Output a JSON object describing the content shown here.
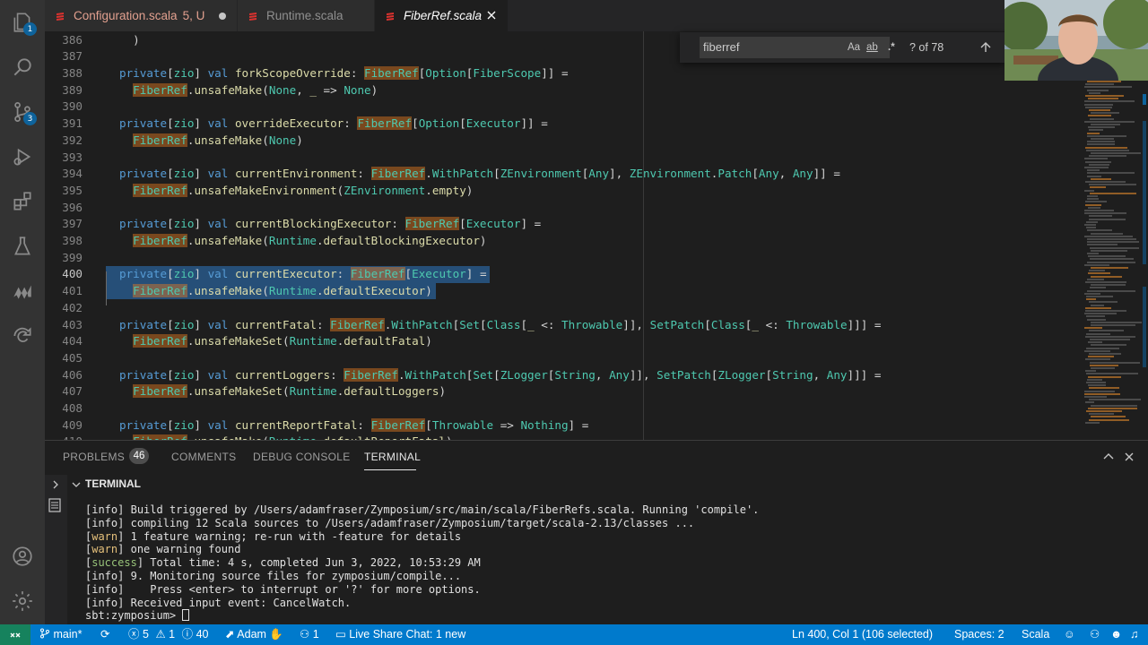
{
  "tabs": [
    {
      "label": "Configuration.scala",
      "status": "5, U"
    },
    {
      "label": "Runtime.scala"
    },
    {
      "label": "FiberRef.scala"
    }
  ],
  "activity_badges": {
    "explorer": "1",
    "source_control": "3"
  },
  "find": {
    "query": "fiberref",
    "opt_case": "Aa",
    "opt_word": "ab",
    "opt_regex": ".*",
    "count": "? of 78"
  },
  "editor_lines": [
    {
      "num": "386",
      "code": "  )"
    },
    {
      "num": "387",
      "code": ""
    },
    {
      "num": "388",
      "code": "private[zio] val forkScopeOverride: FiberRef[Option[FiberScope]] ="
    },
    {
      "num": "389",
      "code": "  FiberRef.unsafeMake(None, _ => None)"
    },
    {
      "num": "390",
      "code": ""
    },
    {
      "num": "391",
      "code": "private[zio] val overrideExecutor: FiberRef[Option[Executor]] ="
    },
    {
      "num": "392",
      "code": "  FiberRef.unsafeMake(None)"
    },
    {
      "num": "393",
      "code": ""
    },
    {
      "num": "394",
      "code": "private[zio] val currentEnvironment: FiberRef.WithPatch[ZEnvironment[Any], ZEnvironment.Patch[Any, Any]] ="
    },
    {
      "num": "395",
      "code": "  FiberRef.unsafeMakeEnvironment(ZEnvironment.empty)"
    },
    {
      "num": "396",
      "code": ""
    },
    {
      "num": "397",
      "code": "private[zio] val currentBlockingExecutor: FiberRef[Executor] ="
    },
    {
      "num": "398",
      "code": "  FiberRef.unsafeMake(Runtime.defaultBlockingExecutor)"
    },
    {
      "num": "399",
      "code": ""
    },
    {
      "num": "400",
      "code": "private[zio] val currentExecutor: FiberRef[Executor] ="
    },
    {
      "num": "401",
      "code": "  FiberRef.unsafeMake(Runtime.defaultExecutor)"
    },
    {
      "num": "402",
      "code": ""
    },
    {
      "num": "403",
      "code": "private[zio] val currentFatal: FiberRef.WithPatch[Set[Class[_ <: Throwable]], SetPatch[Class[_ <: Throwable]]] ="
    },
    {
      "num": "404",
      "code": "  FiberRef.unsafeMakeSet(Runtime.defaultFatal)"
    },
    {
      "num": "405",
      "code": ""
    },
    {
      "num": "406",
      "code": "private[zio] val currentLoggers: FiberRef.WithPatch[Set[ZLogger[String, Any]], SetPatch[ZLogger[String, Any]]] ="
    },
    {
      "num": "407",
      "code": "  FiberRef.unsafeMakeSet(Runtime.defaultLoggers)"
    },
    {
      "num": "408",
      "code": ""
    },
    {
      "num": "409",
      "code": "private[zio] val currentReportFatal: FiberRef[Throwable => Nothing] ="
    },
    {
      "num": "410",
      "code": "  FiberRef.unsafeMake(Runtime.defaultReportFatal)"
    }
  ],
  "panel": {
    "tabs": [
      {
        "label": "PROBLEMS",
        "badge": "46"
      },
      {
        "label": "COMMENTS"
      },
      {
        "label": "DEBUG CONSOLE"
      },
      {
        "label": "TERMINAL"
      }
    ],
    "terminal_title": "TERMINAL",
    "terminal_lines": [
      {
        "tag": "info",
        "text": " Build triggered by /Users/adamfraser/Zymposium/src/main/scala/FiberRefs.scala. Running 'compile'."
      },
      {
        "tag": "info",
        "text": " compiling 12 Scala sources to /Users/adamfraser/Zymposium/target/scala-2.13/classes ..."
      },
      {
        "tag": "warn",
        "text": " 1 feature warning; re-run with -feature for details"
      },
      {
        "tag": "warn",
        "text": " one warning found"
      },
      {
        "tag": "success",
        "text": " Total time: 4 s, completed Jun 3, 2022, 10:53:29 AM"
      },
      {
        "tag": "info",
        "text": " 9. Monitoring source files for zymposium/compile..."
      },
      {
        "tag": "info",
        "text": "    Press <enter> to interrupt or '?' for more options."
      },
      {
        "tag": "info",
        "text": " Received input event: CancelWatch."
      }
    ],
    "prompt": "sbt:zymposium> "
  },
  "status": {
    "branch": "main*",
    "errors": "5",
    "warnings": "1",
    "infos": "40",
    "user": "Adam",
    "ports": "1",
    "live_share": "Live Share Chat: 1 new",
    "position": "Ln 400, Col 1 (106 selected)",
    "spaces": "Spaces: 2",
    "language": "Scala"
  },
  "colors": {
    "accent": "#007acc",
    "find_highlight": "#e87d1e",
    "selection": "#264f78"
  }
}
